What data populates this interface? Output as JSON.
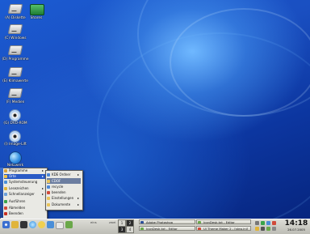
{
  "desktop": {
    "icons": [
      {
        "label": "(A) Diskette",
        "icon": "floppy-drive-icon"
      },
      {
        "label": "Shares",
        "icon": "network-share-icon"
      },
      {
        "label": "(C) Windows",
        "icon": "hard-drive-icon"
      },
      {
        "label": "(D) Programme",
        "icon": "hard-drive-icon"
      },
      {
        "label": "(E) Klimawerte",
        "icon": "hard-drive-icon"
      },
      {
        "label": "(F) Medien",
        "icon": "hard-drive-icon"
      },
      {
        "label": "(G) DVD-ROM",
        "icon": "dvd-icon"
      },
      {
        "label": "(I) Image-Lift",
        "icon": "cd-icon"
      },
      {
        "label": "Netzwerk",
        "icon": "network-globe-icon"
      }
    ]
  },
  "start_menu": {
    "items": [
      {
        "label": "Programme",
        "submenu": true
      },
      {
        "label": "Orte",
        "submenu": true,
        "selected": true
      },
      {
        "label": "Systemsteuerung",
        "submenu": false
      },
      {
        "label": "Lesezeichen",
        "submenu": true
      },
      {
        "label": "Schnellanzeiger",
        "submenu": true
      },
      {
        "label": "Ausführen",
        "submenu": false
      },
      {
        "label": "Abmelden",
        "submenu": false
      },
      {
        "label": "Beenden",
        "submenu": false
      }
    ],
    "submenu": {
      "items": [
        {
          "label": "KDE Ordner",
          "submenu": true
        },
        {
          "label": "CDOF",
          "submenu": false,
          "selected": true
        },
        {
          "label": "recycle",
          "submenu": false
        },
        {
          "label": "beenden",
          "submenu": false
        },
        {
          "label": "Einstellungen",
          "submenu": true
        },
        {
          "label": "Dokumente",
          "submenu": true
        }
      ]
    }
  },
  "taskbar": {
    "quicklaunch_icons": [
      "kde-menu-icon",
      "home-folder-icon",
      "terminal-icon",
      "browser-icon",
      "help-icon",
      "control-center-icon",
      "mail-icon",
      "editor-icon"
    ],
    "desktop_names": [
      "eins",
      "zwei"
    ],
    "pager": [
      "1",
      "2",
      "3",
      "4"
    ],
    "tasks": [
      {
        "label": "Adobe Photoshop"
      },
      {
        "label": "IconDesk.txt - Editor"
      },
      {
        "label": "IconDesk.txt - Editor"
      },
      {
        "label": "Ul Theme Maker 2 - [step.ini]"
      }
    ],
    "clock": {
      "time": "14:18",
      "date": "26.07.2005"
    },
    "colors": {
      "accent": "#2a5bc6",
      "bar": "#d2d2cb"
    }
  }
}
